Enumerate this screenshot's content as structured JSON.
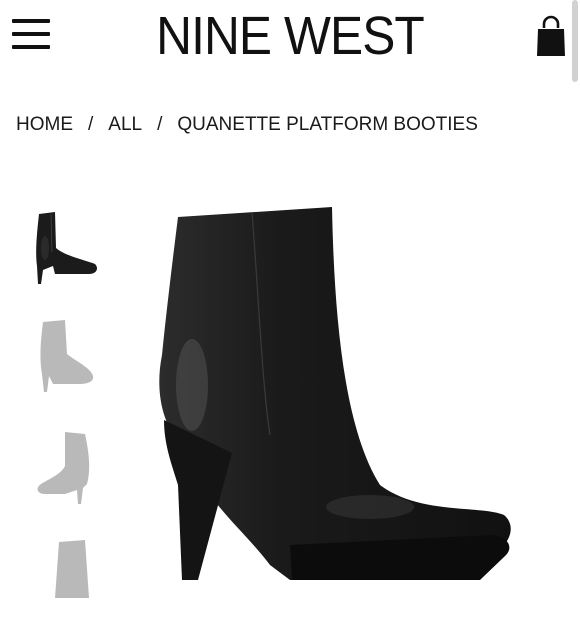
{
  "header": {
    "logo_text": "NINE WEST",
    "menu_icon": "hamburger-menu-icon",
    "bag_icon": "shopping-bag-icon"
  },
  "breadcrumb": {
    "items": [
      "HOME",
      "ALL",
      "QUANETTE PLATFORM BOOTIES"
    ],
    "separator": "/"
  },
  "gallery": {
    "thumbnail_count_visible": 4,
    "selected_index": 0
  },
  "colors": {
    "text": "#111111",
    "boot": "#1b1b1b",
    "background": "#ffffff"
  }
}
